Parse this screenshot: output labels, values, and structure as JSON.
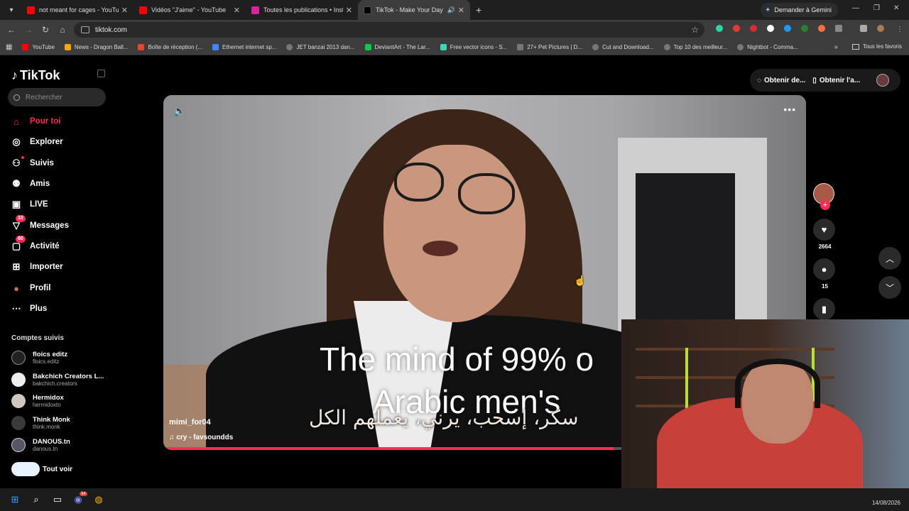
{
  "browser": {
    "tabs": [
      {
        "title": "not meant for cages - YouTube",
        "color": "#ff0000"
      },
      {
        "title": "Vidéos \"J'aime\" - YouTube",
        "color": "#ff0000"
      },
      {
        "title": "Toutes les publications • Instag",
        "color": "#d6249f"
      },
      {
        "title": "TikTok - Make Your Day",
        "color": "#000000"
      }
    ],
    "gemini_label": "Demander à Gemini",
    "url": "tiktok.com",
    "bookmarks": [
      {
        "label": "YouTube",
        "color": "#ff0000"
      },
      {
        "label": "News - Dragon Ball...",
        "color": "#f2a900"
      },
      {
        "label": "Boîte de réception (...",
        "color": "#ea4335"
      },
      {
        "label": "Ethernet internet sp...",
        "color": "#4285f4"
      },
      {
        "label": "JET banzai 2013 dan...",
        "color": "#777777"
      },
      {
        "label": "DeviantArt - The Lar...",
        "color": "#05cc47"
      },
      {
        "label": "Free vector icons - S...",
        "color": "#3ad9b4"
      },
      {
        "label": "27+ Pet Pictures | D...",
        "color": "#777777"
      },
      {
        "label": "Cut and Download...",
        "color": "#777777"
      },
      {
        "label": "Top 10 des meilleur...",
        "color": "#777777"
      },
      {
        "label": "Nightbot - Comma...",
        "color": "#777777"
      }
    ],
    "all_favorites": "Tous les favoris"
  },
  "tiktok": {
    "logo": "TikTok",
    "search_placeholder": "Rechercher",
    "menu": [
      {
        "label": "Pour toi",
        "icon": "home-icon",
        "active": true
      },
      {
        "label": "Explorer",
        "icon": "compass-icon"
      },
      {
        "label": "Suivis",
        "icon": "following-icon"
      },
      {
        "label": "Amis",
        "icon": "friends-icon"
      },
      {
        "label": "LIVE",
        "icon": "live-icon"
      },
      {
        "label": "Messages",
        "icon": "messages-icon",
        "badge": "10"
      },
      {
        "label": "Activité",
        "icon": "activity-icon",
        "badge": "60"
      },
      {
        "label": "Importer",
        "icon": "upload-icon"
      },
      {
        "label": "Profil",
        "icon": "profile-icon"
      },
      {
        "label": "Plus",
        "icon": "more-icon"
      }
    ],
    "following_title": "Comptes suivis",
    "following": [
      {
        "name": "floics editz",
        "handle": "floics.editz"
      },
      {
        "name": "Bakchich Creators L...",
        "handle": "bakchich.creators"
      },
      {
        "name": "Hermidox",
        "handle": "hermidoxtn"
      },
      {
        "name": "Think Monk",
        "handle": "think.monk"
      },
      {
        "name": "DANOUS.tn",
        "handle": "danous.tn"
      }
    ],
    "see_all": "Tout voir",
    "top_actions": {
      "coins": "Obtenir de...",
      "app": "Obtenir l'a..."
    },
    "video": {
      "caption_line1": "The mind of 99% o",
      "caption_line2": "Arabic men's",
      "arabic_text": "سكر، إسحب، يرني، يعملهم الكل",
      "username": "mimi_for04",
      "sound": "cry - favsoundds",
      "progress": 0.7
    },
    "likes": "2664",
    "comments": "15"
  },
  "taskbar": {
    "date": "14/08/2026",
    "discord_badge": "94"
  }
}
